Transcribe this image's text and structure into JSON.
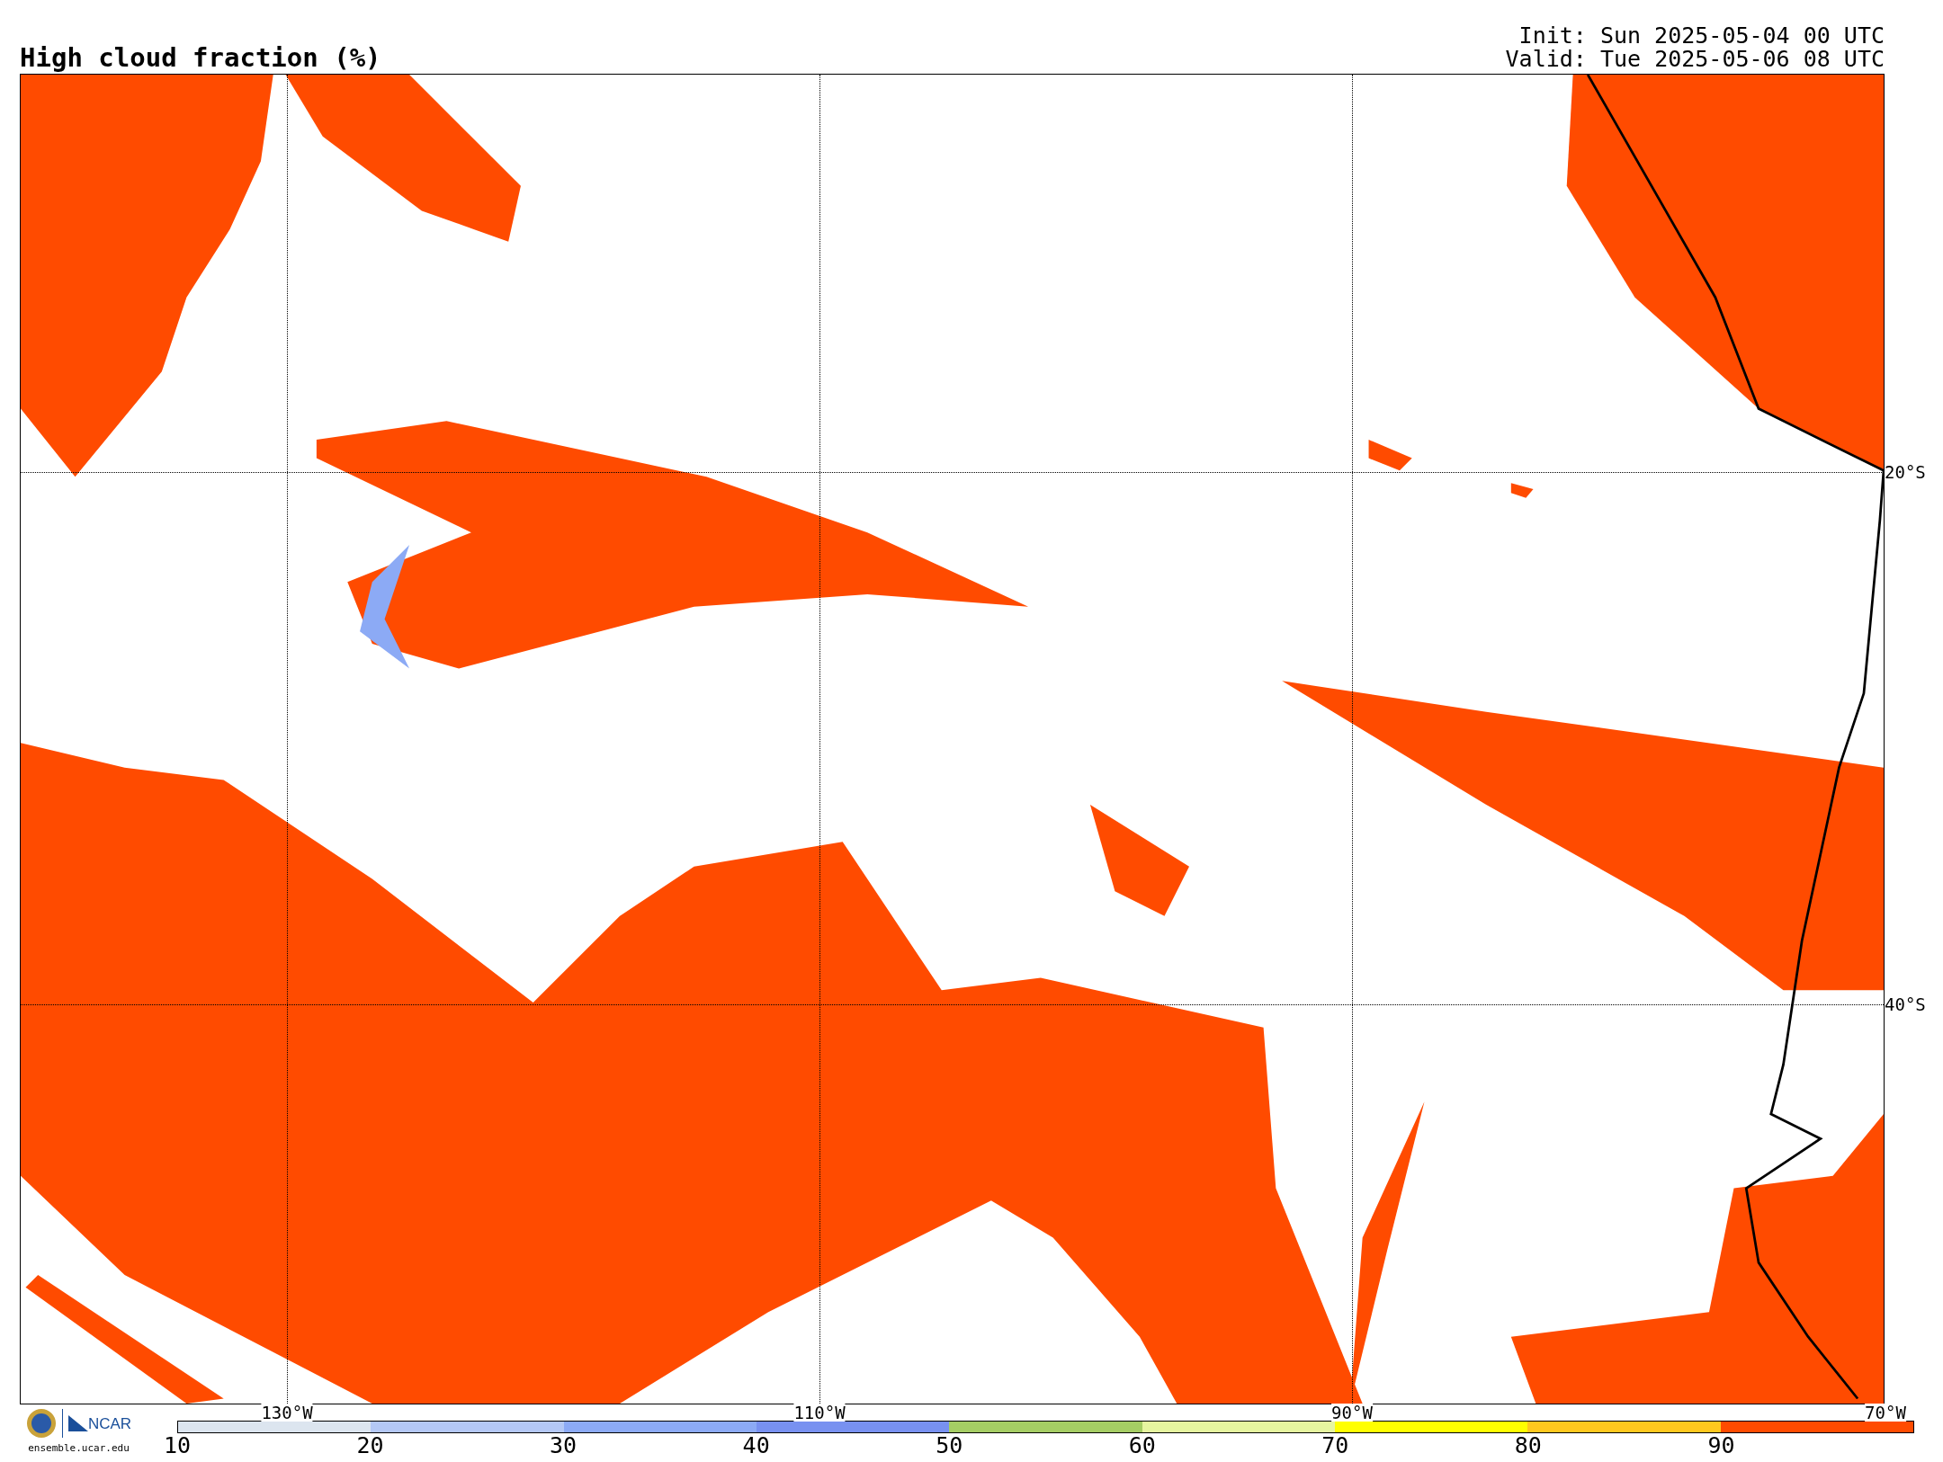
{
  "title": "High cloud fraction (%)",
  "times": [
    "Init: Sun 2025-05-04 00 UTC",
    "Valid: Tue 2025-05-06 08 UTC"
  ],
  "map": {
    "lon_labels": [
      "130°W",
      "110°W",
      "90°W",
      "70°W"
    ],
    "lat_labels": [
      "20°S",
      "40°S"
    ]
  },
  "logos": {
    "org": "NCAR",
    "site": "ensemble.ucar.edu"
  },
  "colorbar": {
    "ticks": [
      "10",
      "20",
      "30",
      "40",
      "50",
      "60",
      "70",
      "80",
      "90"
    ],
    "bins": [
      {
        "color": "#dce5ef"
      },
      {
        "color": "#b4c8f5"
      },
      {
        "color": "#8caaf5"
      },
      {
        "color": "#7891f0"
      },
      {
        "color": "#a5cd64"
      },
      {
        "color": "#e6f5a0"
      },
      {
        "color": "#ffff00"
      },
      {
        "color": "#ffc81e"
      },
      {
        "color": "#ff4b00"
      }
    ]
  }
}
